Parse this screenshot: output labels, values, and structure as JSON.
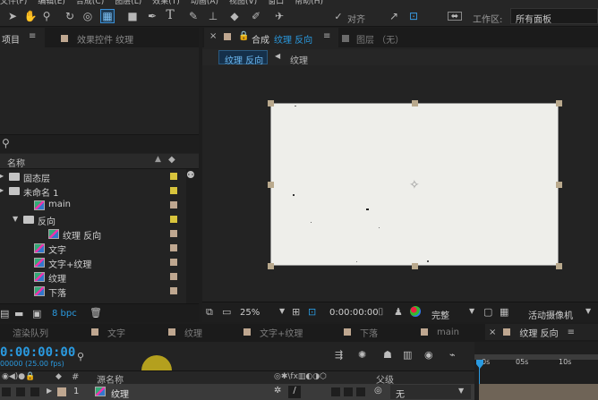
{
  "menubar": {
    "items": [
      "文件(F)",
      "编辑(E)",
      "合成(C)",
      "图层(L)",
      "效果(T)",
      "动画(A)",
      "视图(V)",
      "窗口",
      "帮助(H)"
    ]
  },
  "toolbar": {
    "align_label": "对齐",
    "workspace_label": "工作区:",
    "workspace_value": "所有面板"
  },
  "project_panel": {
    "tab_label": "项目",
    "effects_tab_label": "效果控件 纹理",
    "column_name": "名称",
    "items": [
      {
        "label": "固态层",
        "level": 0,
        "type": "folder",
        "color": "#d8c43c"
      },
      {
        "label": "未命名 1",
        "level": 0,
        "type": "folder",
        "color": "#d8c43c"
      },
      {
        "label": "main",
        "level": 1,
        "type": "comp",
        "color": "#bfa790"
      },
      {
        "label": "反向",
        "level": 1,
        "type": "folder",
        "color": "#d8c43c"
      },
      {
        "label": "纹理 反向",
        "level": 2,
        "type": "comp",
        "color": "#bfa790"
      },
      {
        "label": "文字",
        "level": 1,
        "type": "comp",
        "color": "#bfa790"
      },
      {
        "label": "文字+纹理",
        "level": 1,
        "type": "comp",
        "color": "#bfa790"
      },
      {
        "label": "纹理",
        "level": 1,
        "type": "comp",
        "color": "#bfa790"
      },
      {
        "label": "下落",
        "level": 1,
        "type": "comp",
        "color": "#bfa790"
      }
    ],
    "bpc": "8 bpc"
  },
  "composition_panel": {
    "tab_prefix": "合成",
    "tab_name": "纹理 反向",
    "layer_tab": "图层 （无）",
    "breadcrumb_active": "纹理 反向",
    "breadcrumb_next": "纹理",
    "zoom": "25%",
    "timecode": "0:00:00:00",
    "quality": "完整",
    "camera": "活动摄像机"
  },
  "timeline": {
    "tabs": [
      {
        "label": "渲染队列",
        "color": ""
      },
      {
        "label": "文字",
        "color": "#bfa790"
      },
      {
        "label": "纹理",
        "color": "#bfa790"
      },
      {
        "label": "文字+纹理",
        "color": "#bfa790"
      },
      {
        "label": "下落",
        "color": "#bfa790"
      },
      {
        "label": "main",
        "color": "#bfa790"
      },
      {
        "label": "纹理 反向",
        "color": "#bfa790"
      }
    ],
    "timecode": "0:00:00:00",
    "fps": "00000 (25.00 fps)",
    "col_source_name": "源名称",
    "col_parent": "父级",
    "ruler": [
      "0s",
      "05s",
      "10s"
    ],
    "layer": {
      "index": "1",
      "name": "纹理",
      "parent": "无"
    }
  },
  "colors": {
    "accent": "#2a9ae0",
    "label_yellow": "#d8c43c",
    "label_tan": "#bfa790",
    "cursor_highlight": "#c8b21e"
  }
}
